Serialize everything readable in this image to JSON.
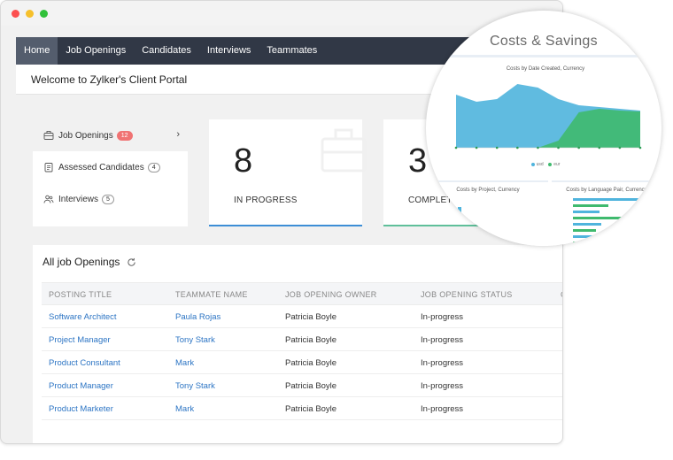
{
  "nav": {
    "items": [
      {
        "label": "Home",
        "active": true
      },
      {
        "label": "Job Openings"
      },
      {
        "label": "Candidates"
      },
      {
        "label": "Interviews"
      },
      {
        "label": "Teammates"
      }
    ]
  },
  "welcome": {
    "title": "Welcome to Zylker's Client Portal"
  },
  "sidebar": {
    "items": [
      {
        "label": "Job Openings",
        "count": "12",
        "icon": "briefcase-icon"
      },
      {
        "label": "Assessed Candidates",
        "count": "4",
        "icon": "clipboard-icon"
      },
      {
        "label": "Interviews",
        "count": "5",
        "icon": "people-icon"
      }
    ],
    "chevron": "›"
  },
  "stats": {
    "in_progress": {
      "value": "8",
      "label": "IN PROGRESS"
    },
    "completed": {
      "value": "3",
      "label": "COMPLETED"
    }
  },
  "table": {
    "title": "All job Openings",
    "columns": [
      "POSTING TITLE",
      "TEAMMATE NAME",
      "JOB OPENING OWNER",
      "JOB OPENING STATUS",
      "C"
    ],
    "rows": [
      {
        "title": "Software Architect",
        "teammate": "Paula Rojas",
        "owner": "Patricia Boyle",
        "status": "In-progress"
      },
      {
        "title": "Project Manager",
        "teammate": "Tony Stark",
        "owner": "Patricia Boyle",
        "status": "In-progress"
      },
      {
        "title": "Product Consultant",
        "teammate": "Mark",
        "owner": "Patricia Boyle",
        "status": "In-progress"
      },
      {
        "title": "Product Manager",
        "teammate": "Tony Stark",
        "owner": "Patricia Boyle",
        "status": "In-progress"
      },
      {
        "title": "Product Marketer",
        "teammate": "Mark",
        "owner": "Patricia Boyle",
        "status": "In-progress"
      }
    ]
  },
  "magnifier": {
    "title": "Costs & Savings",
    "panels": {
      "date": "Costs by Date Created, Currency",
      "project": "Costs by Project, Currency",
      "language": "Costs by Language Pair, Currency"
    },
    "legend": [
      "usd",
      "eur"
    ]
  },
  "colors": {
    "nav_bg": "#313846",
    "link": "#2d75c4",
    "series_usd": "#4fb4dd",
    "series_eur": "#3fba6e",
    "badge": "#f07373"
  },
  "chart_data": {
    "type": "area",
    "title": "Costs by Date Created, Currency",
    "x": [
      1,
      2,
      3,
      4,
      5,
      6,
      7,
      8,
      9,
      10
    ],
    "series": [
      {
        "name": "usd",
        "values": [
          60,
          52,
          55,
          72,
          68,
          55,
          48,
          46,
          44,
          42
        ]
      },
      {
        "name": "eur",
        "values": [
          0,
          0,
          0,
          0,
          0,
          8,
          40,
          44,
          42,
          41
        ]
      }
    ],
    "ylim": [
      0,
      80
    ],
    "grid": false,
    "legend": "bottom"
  }
}
